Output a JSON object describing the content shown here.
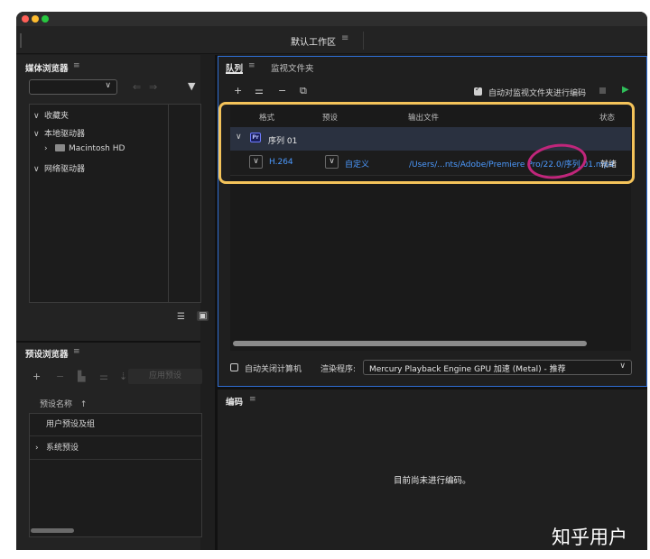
{
  "workspace": {
    "title": "默认工作区",
    "menu_icon": "≡"
  },
  "media_browser": {
    "title": "媒体浏览器",
    "menu_icon": "≡",
    "dropdown_value": "",
    "tree": [
      {
        "label": "收藏夹",
        "caret": "∨"
      },
      {
        "label": "本地驱动器",
        "caret": "∨"
      },
      {
        "label": "Macintosh HD",
        "caret": "›"
      },
      {
        "label": "网络驱动器",
        "caret": "∨"
      }
    ]
  },
  "preset_browser": {
    "title": "预设浏览器",
    "menu_icon": "≡",
    "apply_button": "应用预设",
    "column_header": "预设名称",
    "sort_icon": "↑",
    "rows": [
      {
        "label": "用户预设及组",
        "caret": ""
      },
      {
        "label": "系统预设",
        "caret": "›"
      }
    ]
  },
  "queue": {
    "tabs": [
      {
        "label": "队列"
      },
      {
        "label": "监视文件夹"
      }
    ],
    "menu_icon": "≡",
    "auto_encode_label": "自动对监视文件夹进行编码",
    "auto_encode_checked": true,
    "columns": {
      "format": "格式",
      "preset": "预设",
      "output": "输出文件",
      "status": "状态"
    },
    "sequence": {
      "badge": "Pr",
      "name": "序列 01"
    },
    "item": {
      "format": "H.264",
      "preset": "自定义",
      "output": "/Users/...nts/Adobe/Premiere Pro/22.0/序列 01.mp4",
      "status": "就绪"
    },
    "shutdown_label": "自动关闭计算机",
    "shutdown_checked": false,
    "renderer_label": "渲染程序:",
    "renderer_value": "Mercury Playback Engine GPU 加速 (Metal) - 推荐"
  },
  "encoding": {
    "title": "编码",
    "menu_icon": "≡",
    "message": "目前尚未进行编码。"
  },
  "watermark": "知乎用户",
  "colors": {
    "accent_blue": "#2f6fd6",
    "link": "#4c9aff",
    "play_green": "#2fbf5a",
    "highlight": "#f4c35a",
    "circle": "#c0267b"
  }
}
